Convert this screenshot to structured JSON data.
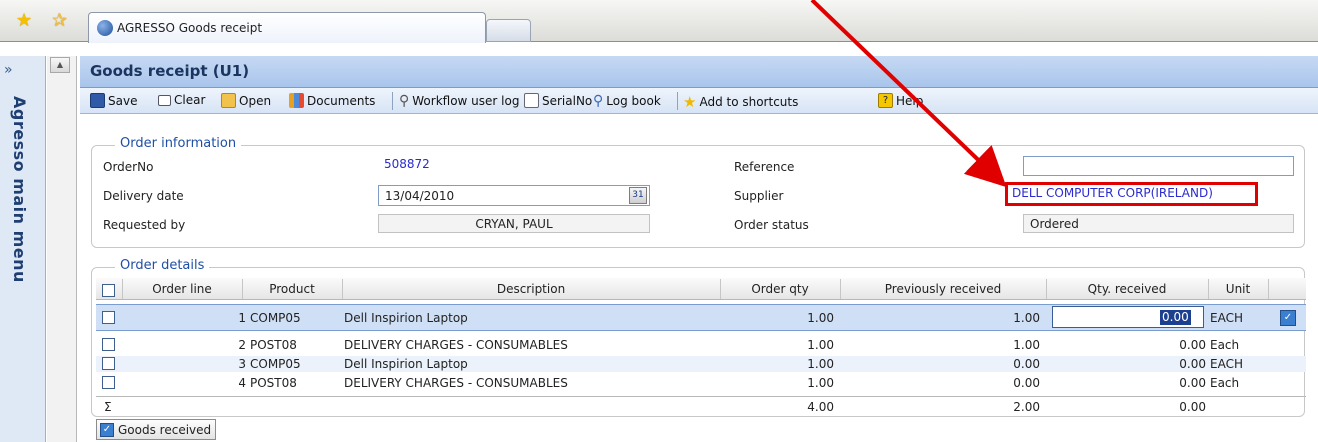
{
  "tabs": {
    "active_label": "AGRESSO Goods receipt"
  },
  "sidebar": {
    "expand_label": "»",
    "label": "Agresso main menu"
  },
  "header": {
    "title": "Goods receipt (U1)"
  },
  "toolbar": {
    "save": "Save",
    "clear": "Clear",
    "open": "Open",
    "documents": "Documents",
    "workflow": "Workflow user log",
    "serial": "SerialNo",
    "logbook": "Log book",
    "shortcuts": "Add to shortcuts",
    "help": "Help"
  },
  "order_info": {
    "legend": "Order information",
    "order_no_label": "OrderNo",
    "order_no": "508872",
    "delivery_label": "Delivery date",
    "delivery_date": "13/04/2010",
    "requested_label": "Requested by",
    "requested_by": "CRYAN, PAUL",
    "reference_label": "Reference",
    "reference": "",
    "supplier_label": "Supplier",
    "supplier": "DELL COMPUTER CORP(IRELAND)",
    "status_label": "Order status",
    "status": "Ordered"
  },
  "order_details": {
    "legend": "Order details",
    "columns": [
      "Order line",
      "Product",
      "Description",
      "Order qty",
      "Previously received",
      "Qty. received",
      "Unit"
    ],
    "rows": [
      {
        "line": "1",
        "product": "COMP05",
        "description": "Dell Inspirion Laptop",
        "order_qty": "1.00",
        "prev": "1.00",
        "qty": "0.00",
        "unit": "EACH"
      },
      {
        "line": "2",
        "product": "POST08",
        "description": "DELIVERY CHARGES - CONSUMABLES",
        "order_qty": "1.00",
        "prev": "1.00",
        "qty": "0.00",
        "unit": "Each"
      },
      {
        "line": "3",
        "product": "COMP05",
        "description": "Dell Inspirion Laptop",
        "order_qty": "1.00",
        "prev": "0.00",
        "qty": "0.00",
        "unit": "EACH"
      },
      {
        "line": "4",
        "product": "POST08",
        "description": "DELIVERY CHARGES - CONSUMABLES",
        "order_qty": "1.00",
        "prev": "0.00",
        "qty": "0.00",
        "unit": "Each"
      }
    ],
    "totals": {
      "symbol": "Σ",
      "order_qty": "4.00",
      "prev": "2.00",
      "qty": "0.00"
    }
  },
  "footer": {
    "goods_received": "Goods received"
  },
  "colors": {
    "accent": "#1f4fa5",
    "highlight_row": "#cfe0f6",
    "callout": "#e00000"
  },
  "icons": [
    "star-icon",
    "star-add-icon",
    "globe-icon",
    "save-icon",
    "clear-icon",
    "open-folder-icon",
    "documents-icon",
    "search-icon",
    "serial-icon",
    "log-book-icon",
    "shortcut-star-icon",
    "help-icon",
    "calendar-icon"
  ]
}
